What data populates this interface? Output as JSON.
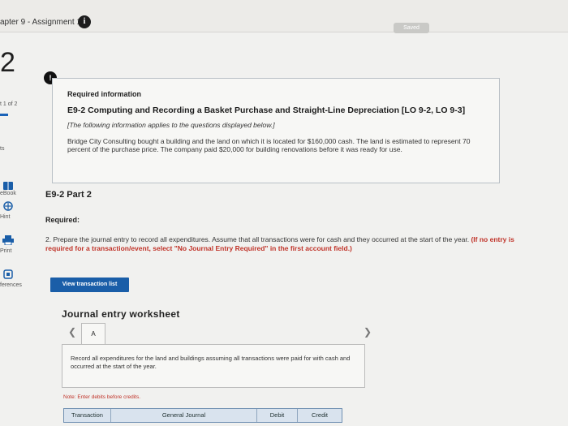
{
  "header": {
    "chapter_title": "apter 9 - Assignment 1",
    "info_icon": "i",
    "saved_label": "Saved"
  },
  "question": {
    "number": "2",
    "alert": "!"
  },
  "left_rail": {
    "progress": "t 1 of 2",
    "ts": "ts",
    "ebook": "eBook",
    "hint": "Hint",
    "print": "Print",
    "references": "ferences"
  },
  "required_info": {
    "heading": "Required information",
    "title": "E9-2 Computing and Recording a Basket Purchase and Straight-Line Depreciation [LO 9-2, LO 9-3]",
    "italic_note": "[The following information applies to the questions displayed below.]",
    "body": "Bridge City Consulting bought a building and the land on which it is located for $160,000 cash. The land is estimated to represent 70 percent of the purchase price. The company paid $20,000 for building renovations before it was ready for use."
  },
  "part": {
    "title": "E9-2 Part 2",
    "required_label": "Required:",
    "instruction_prefix": "2. Prepare the journal entry to record all expenditures. Assume that all transactions were for cash and they occurred at the start of the year.",
    "instruction_bold": "(If no entry is required for a transaction/event, select \"No Journal Entry Required\" in the first account field.)",
    "view_transaction_list": "View transaction list"
  },
  "worksheet": {
    "heading": "Journal entry worksheet",
    "tab_label": "A",
    "panel_text": "Record all expenditures for the land and buildings assuming all transactions were paid for with cash and occurred at the start of the year.",
    "note_label": "Note:",
    "note_text": "Enter debits before credits.",
    "columns": [
      "Transaction",
      "General Journal",
      "Debit",
      "Credit"
    ]
  },
  "colors": {
    "accent_blue": "#1a5ea8",
    "warning_red": "#c03329"
  }
}
